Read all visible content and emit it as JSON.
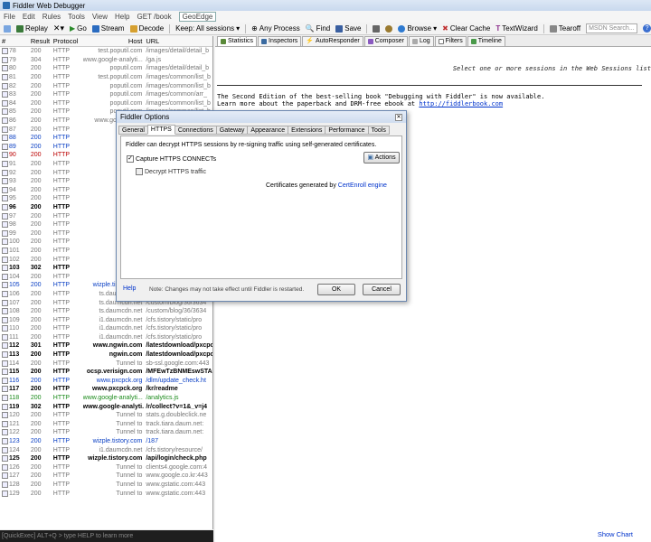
{
  "window": {
    "title": "Fiddler Web Debugger"
  },
  "menu": [
    "File",
    "Edit",
    "Rules",
    "Tools",
    "View",
    "Help",
    "GET /book",
    "GeoEdge"
  ],
  "toolbar": {
    "replay": "Replay",
    "go": "Go",
    "stream": "Stream",
    "decode": "Decode",
    "keep": "Keep: All sessions",
    "process": "Any Process",
    "find": "Find",
    "save": "Save",
    "browse": "Browse",
    "clear_cache": "Clear Cache",
    "textwizard": "TextWizard",
    "tearoff": "Tearoff",
    "search_placeholder": "MSDN Search..."
  },
  "grid": {
    "headers": [
      "#",
      "Result",
      "Protocol",
      "Host",
      "URL"
    ]
  },
  "sessions": [
    [
      "78",
      "200",
      "HTTP",
      "test.poputil.com",
      "/images/detail/detail_b",
      "grey"
    ],
    [
      "79",
      "304",
      "HTTP",
      "www.google-analyti...",
      "/ga.js",
      "grey"
    ],
    [
      "80",
      "200",
      "HTTP",
      "poputil.com",
      "/images/detail/detail_b",
      "grey"
    ],
    [
      "81",
      "200",
      "HTTP",
      "test.poputil.com",
      "/images/common/list_b",
      "grey"
    ],
    [
      "82",
      "200",
      "HTTP",
      "poputil.com",
      "/images/common/list_b",
      "grey"
    ],
    [
      "83",
      "200",
      "HTTP",
      "poputil.com",
      "/images/common/arr_",
      "grey"
    ],
    [
      "84",
      "200",
      "HTTP",
      "poputil.com",
      "/images/common/list_b",
      "grey"
    ],
    [
      "85",
      "200",
      "HTTP",
      "poputil.com",
      "/images/common/list_b",
      "grey"
    ],
    [
      "86",
      "200",
      "HTTP",
      "www.google.com",
      "",
      "grey"
    ],
    [
      "87",
      "200",
      "HTTP",
      "",
      "",
      "grey"
    ],
    [
      "88",
      "200",
      "HTTP",
      "tab2.dic",
      "",
      "blue"
    ],
    [
      "89",
      "200",
      "HTTP",
      "wizple.",
      "",
      "blue"
    ],
    [
      "90",
      "200",
      "HTTP",
      "ts.da",
      "",
      "red"
    ],
    [
      "91",
      "200",
      "HTTP",
      "ts.da",
      "",
      "grey"
    ],
    [
      "92",
      "200",
      "HTTP",
      "cfile1.uf.",
      "",
      "grey"
    ],
    [
      "93",
      "200",
      "HTTP",
      "i1.da",
      "",
      "grey"
    ],
    [
      "94",
      "200",
      "HTTP",
      "i1.da",
      "",
      "grey"
    ],
    [
      "95",
      "200",
      "HTTP",
      "i1.da",
      "",
      "grey"
    ],
    [
      "96",
      "200",
      "HTTP",
      "wizple.",
      "",
      "bold"
    ],
    [
      "97",
      "200",
      "HTTP",
      "ts.da",
      "",
      "grey"
    ],
    [
      "98",
      "200",
      "HTTP",
      "ts.da",
      "",
      "grey"
    ],
    [
      "99",
      "200",
      "HTTP",
      "ts.da",
      "",
      "grey"
    ],
    [
      "100",
      "200",
      "HTTP",
      "ts.da",
      "",
      "grey"
    ],
    [
      "101",
      "200",
      "HTTP",
      "ts.da",
      "",
      "grey"
    ],
    [
      "102",
      "200",
      "HTTP",
      "ts.da",
      "",
      "grey"
    ],
    [
      "103",
      "302",
      "HTTP",
      "wizple.",
      "",
      "bold"
    ],
    [
      "104",
      "200",
      "HTTP",
      "",
      "",
      "grey"
    ],
    [
      "105",
      "200",
      "HTTP",
      "wizple.tistory.com",
      "/api/comment/comme",
      "blue"
    ],
    [
      "106",
      "200",
      "HTTP",
      "ts.daumcdn.net",
      "/custom/blog/36/3634",
      "grey"
    ],
    [
      "107",
      "200",
      "HTTP",
      "ts.daumcdn.net",
      "/custom/blog/36/3634",
      "grey"
    ],
    [
      "108",
      "200",
      "HTTP",
      "ts.daumcdn.net",
      "/custom/blog/36/3634",
      "grey"
    ],
    [
      "109",
      "200",
      "HTTP",
      "i1.daumcdn.net",
      "/cfs.tistory/static/pro",
      "grey"
    ],
    [
      "110",
      "200",
      "HTTP",
      "i1.daumcdn.net",
      "/cfs.tistory/static/pro",
      "grey"
    ],
    [
      "111",
      "200",
      "HTTP",
      "i1.daumcdn.net",
      "/cfs.tistory/static/pro",
      "grey"
    ],
    [
      "112",
      "301",
      "HTTP",
      "www.ngwin.com",
      "/latestdownload/pxcpc",
      "bold"
    ],
    [
      "113",
      "200",
      "HTTP",
      "ngwin.com",
      "/latestdownload/pxcpc",
      "bold"
    ],
    [
      "114",
      "200",
      "HTTP",
      "Tunnel to",
      "sb-ssl.google.com:443",
      "grey"
    ],
    [
      "115",
      "200",
      "HTTP",
      "ocsp.verisign.com",
      "/MFEwTzBNMEswSTA",
      "bold"
    ],
    [
      "116",
      "200",
      "HTTP",
      "www.pxcpck.org",
      "/dlm/update_check.ht",
      "blue"
    ],
    [
      "117",
      "200",
      "HTTP",
      "www.pxcpck.org",
      "/kr/readme",
      "bold"
    ],
    [
      "118",
      "200",
      "HTTP",
      "www.google-analyti...",
      "/analytics.js",
      "green"
    ],
    [
      "119",
      "302",
      "HTTP",
      "www.google-analyti...",
      "/r/collect?v=1&_v=j4",
      "bold"
    ],
    [
      "120",
      "200",
      "HTTP",
      "Tunnel to",
      "stats.g.doubleclick.ne",
      "grey"
    ],
    [
      "121",
      "200",
      "HTTP",
      "Tunnel to",
      "track.tiara.daum.net:",
      "grey"
    ],
    [
      "122",
      "200",
      "HTTP",
      "Tunnel to",
      "track.tiara.daum.net:",
      "grey"
    ],
    [
      "123",
      "200",
      "HTTP",
      "wizple.tistory.com",
      "/187",
      "blue"
    ],
    [
      "124",
      "200",
      "HTTP",
      "i1.daumcdn.net",
      "/cfs.tistory/resource/",
      "grey"
    ],
    [
      "125",
      "200",
      "HTTP",
      "wizple.tistory.com",
      "/api/login/check.php",
      "bold"
    ],
    [
      "126",
      "200",
      "HTTP",
      "Tunnel to",
      "clients4.google.com:4",
      "grey"
    ],
    [
      "127",
      "200",
      "HTTP",
      "Tunnel to",
      "www.google.co.kr:443",
      "grey"
    ],
    [
      "128",
      "200",
      "HTTP",
      "Tunnel to",
      "www.gstatic.com:443",
      "grey"
    ],
    [
      "129",
      "200",
      "HTTP",
      "Tunnel to",
      "www.gstatic.com:443",
      "grey"
    ]
  ],
  "quickexec": "[QuickExec] ALT+Q > type HELP to learn more",
  "right_tabs": [
    "Statistics",
    "Inspectors",
    "AutoResponder",
    "Composer",
    "Log",
    "Filters",
    "Timeline"
  ],
  "right": {
    "select_msg": "Select one or more sessions in the Web Sessions list",
    "book_line1": "The Second Edition of the best-selling book \"Debugging with Fiddler\" is now available.",
    "book_line2": "Learn more about the paperback and DRM-free ebook at ",
    "book_link": "http://fiddlerbook.com",
    "show_chart": "Show Chart"
  },
  "dialog": {
    "title": "Fiddler Options",
    "tabs": [
      "General",
      "HTTPS",
      "Connections",
      "Gateway",
      "Appearance",
      "Extensions",
      "Performance",
      "Tools"
    ],
    "desc": "Fiddler can decrypt HTTPS sessions by re-signing traffic using self-generated certificates.",
    "capture": "Capture HTTPS CONNECTs",
    "decrypt": "Decrypt HTTPS traffic",
    "actions": "Actions",
    "cert_prefix": "Certificates generated by ",
    "cert_engine": "CertEnroll engine",
    "help": "Help",
    "note": "Note: Changes may not take effect until Fiddler is restarted.",
    "ok": "OK",
    "cancel": "Cancel"
  }
}
